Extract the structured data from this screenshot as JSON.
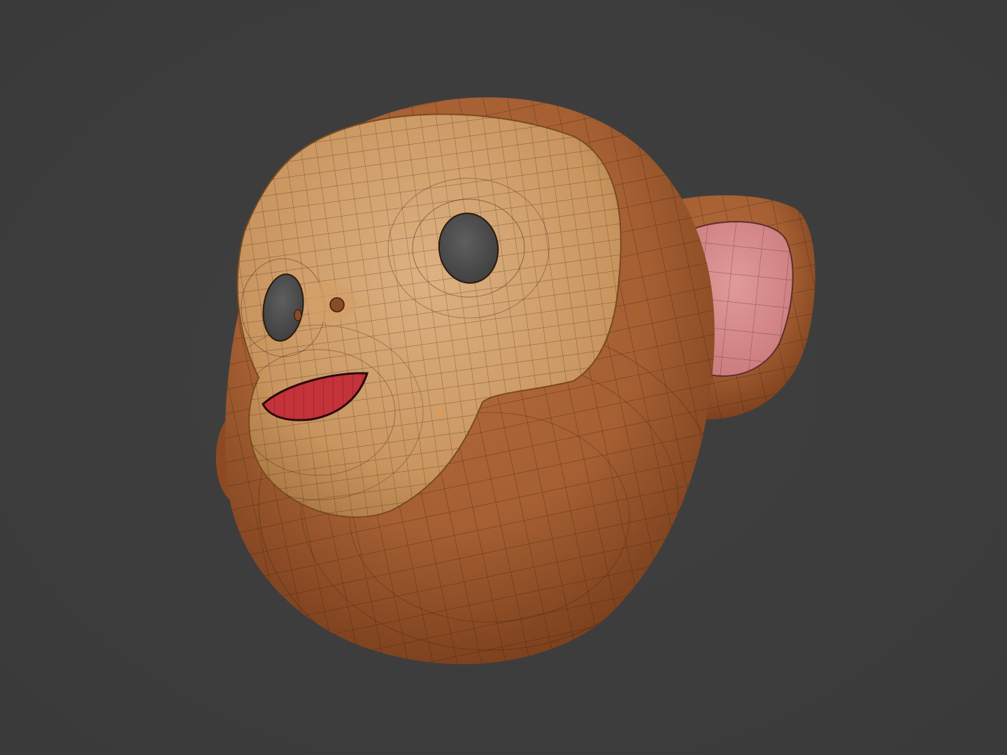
{
  "viewport": {
    "background": "#3a3a3a",
    "background_inner": "#404040"
  },
  "model": {
    "subject": "monkey-head",
    "shading": "solid-with-wireframe",
    "colors": {
      "fur": "#a55f32",
      "fur_dark": "#6e3616",
      "face": "#c9955f",
      "face_light": "#ddb282",
      "inner_ear": "#c9787a",
      "inner_ear_light": "#e09a9a",
      "mouth": "#c4323a",
      "eye_socket": "#505050",
      "nostril": "#8c4a26",
      "wire": "#2a1a0e",
      "vertex_dot": "#ff9a1a"
    }
  }
}
